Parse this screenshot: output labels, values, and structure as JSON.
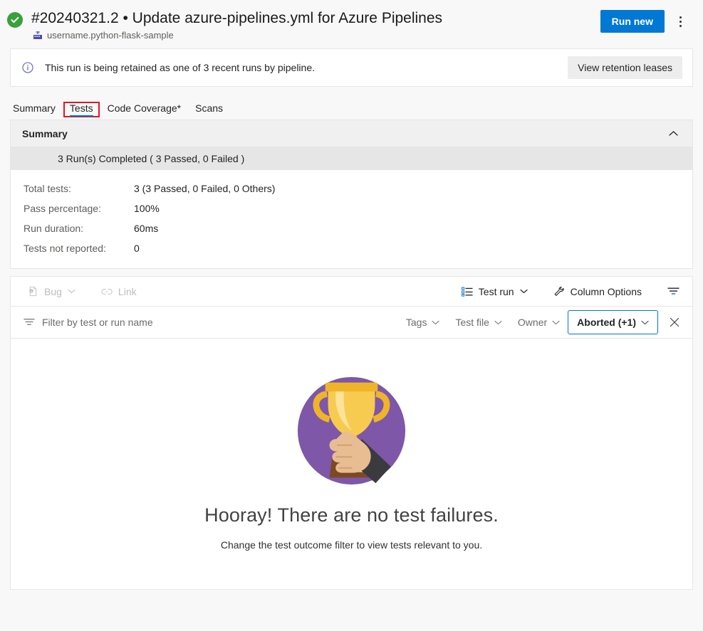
{
  "header": {
    "status_icon": "check-circle-icon",
    "status_color": "#3aa03a",
    "run_title": "#20240321.2 • Update azure-pipelines.yml for Azure Pipelines",
    "pipeline_icon": "pipeline-icon",
    "pipeline_name": "username.python-flask-sample",
    "run_new_label": "Run new",
    "run_new_color": "#0078d4",
    "more_actions_icon": "more-vertical-icon"
  },
  "banner": {
    "icon": "info-icon",
    "icon_color": "#0078d4",
    "message": "This run is being retained as one of 3 recent runs by pipeline.",
    "action_label": "View retention leases"
  },
  "tabs": {
    "selected": "Tests",
    "highlight_color": "#e81123",
    "underline_color": "#0078d4",
    "items": [
      {
        "label": "Summary"
      },
      {
        "label": "Tests"
      },
      {
        "label": "Code Coverage*"
      },
      {
        "label": "Scans"
      }
    ]
  },
  "summary": {
    "header_title": "Summary",
    "collapse_icon": "chevron-up-icon",
    "runs_line": "3 Run(s) Completed ( 3 Passed, 0 Failed )",
    "stats": [
      {
        "label": "Total tests:",
        "value": "3 (3 Passed, 0 Failed, 0 Others)"
      },
      {
        "label": "Pass percentage:",
        "value": "100%"
      },
      {
        "label": "Run duration:",
        "value": "60ms"
      },
      {
        "label": "Tests not reported:",
        "value": "0"
      }
    ]
  },
  "toolbar": {
    "bug_label": "Bug",
    "bug_icon": "bug-report-icon",
    "bug_chevron_icon": "chevron-down-icon",
    "link_label": "Link",
    "link_icon": "link-icon",
    "test_run_label": "Test run",
    "test_run_icon": "group-list-icon",
    "test_run_chevron_icon": "chevron-down-icon",
    "column_options_label": "Column Options",
    "column_options_icon": "wrench-icon",
    "filter_toggle_icon": "filter-icon"
  },
  "filters": {
    "filter_icon": "filter-icon",
    "search_placeholder": "Filter by test or run name",
    "search_value": "",
    "tags_label": "Tags",
    "test_file_label": "Test file",
    "owner_label": "Owner",
    "outcome_label": "Aborted (+1)",
    "outcome_active_border": "#0078d4",
    "clear_icon": "close-icon"
  },
  "empty_state": {
    "illustration": "trophy-in-hand-icon",
    "circle_color": "#7e57a8",
    "trophy_color": "#f5c243",
    "title": "Hooray! There are no test failures.",
    "subtitle": "Change the test outcome filter to view tests relevant to you."
  }
}
